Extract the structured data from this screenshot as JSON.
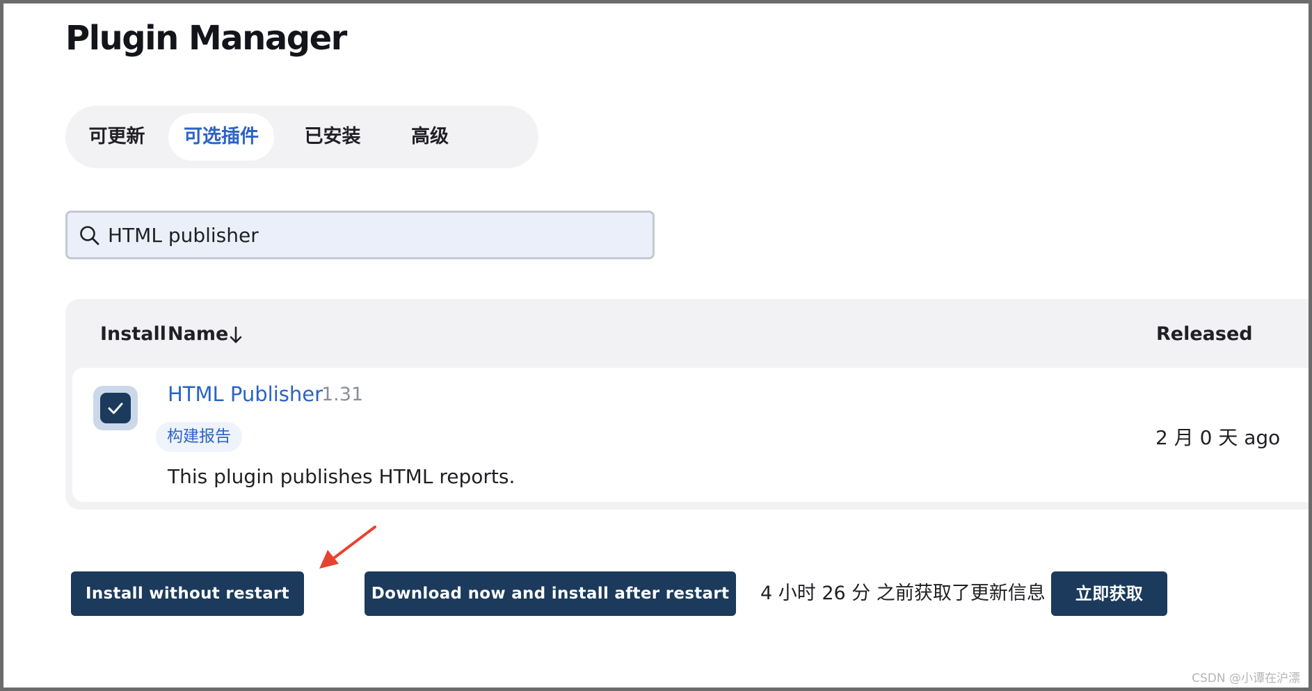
{
  "page": {
    "title": "Plugin Manager"
  },
  "tabs": [
    {
      "label": "可更新",
      "active": false
    },
    {
      "label": "可选插件",
      "active": true
    },
    {
      "label": "已安装",
      "active": false
    },
    {
      "label": "高级",
      "active": false
    }
  ],
  "search": {
    "value": "HTML publisher",
    "icon": "search-icon"
  },
  "table": {
    "columns": {
      "install": "Install",
      "name": "Name",
      "released": "Released"
    },
    "sort_icon": "arrow-down-icon",
    "rows": [
      {
        "checked": true,
        "name": "HTML Publisher",
        "version": "1.31",
        "category": "构建报告",
        "description": "This plugin publishes HTML reports.",
        "released": "2 月 0 天 ago"
      }
    ]
  },
  "actions": {
    "install_without_restart": "Install without restart",
    "download_and_install_after_restart": "Download now and install after restart",
    "update_info": "4 小时 26 分 之前获取了更新信息",
    "fetch_now": "立即获取"
  },
  "watermark": "CSDN @小谭在沪漂",
  "colors": {
    "accent": "#2a63c4",
    "button_bg": "#1b3a5c",
    "annotation_arrow": "#e8432e"
  }
}
